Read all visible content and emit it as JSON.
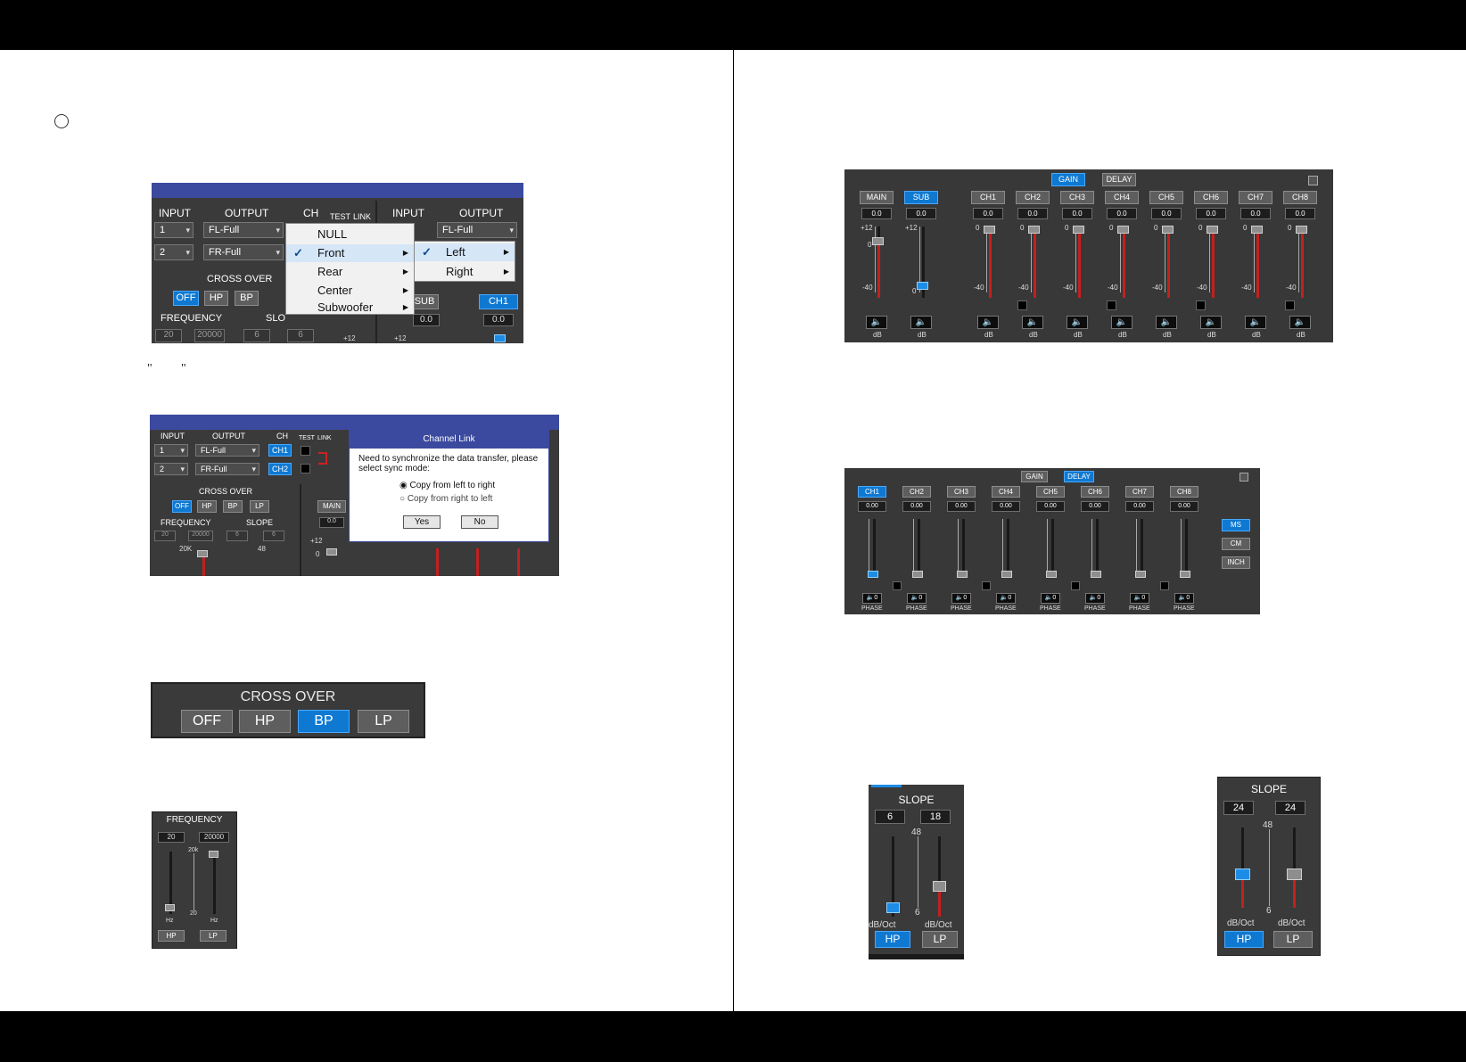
{
  "page": {
    "quote_open": "\"",
    "quote_close": "\""
  },
  "fig1": {
    "rows": [
      {
        "input": "1",
        "output": "FL-Full"
      },
      {
        "input": "2",
        "output": "FR-Full"
      }
    ],
    "headers": {
      "input": "INPUT",
      "output": "OUTPUT",
      "ch": "CH",
      "test": "TEST",
      "link": "LINK"
    },
    "right_headers": {
      "input": "INPUT",
      "output": "OUTPUT"
    },
    "right_output": "FL-Full",
    "crossover_label": "CROSS OVER",
    "crossover_buttons": [
      "OFF",
      "HP",
      "BP"
    ],
    "frequency_label": "FREQUENCY",
    "slope_label": "SLO",
    "freq_values": [
      "20",
      "20000"
    ],
    "slope_values": [
      "6",
      "6"
    ],
    "sub_label": "SUB",
    "sub_value": "0.0",
    "ch1_label": "CH1",
    "ch1_value": "0.0",
    "tick_values": [
      "+12",
      "+12"
    ],
    "menu": [
      "NULL",
      "Front",
      "Rear",
      "Center",
      "Subwoofer"
    ],
    "submenu": [
      "Left",
      "Right"
    ]
  },
  "fig2": {
    "headers": {
      "input": "INPUT",
      "output": "OUTPUT",
      "ch": "CH",
      "test": "TEST",
      "link": "LINK"
    },
    "rows": [
      {
        "input": "1",
        "output": "FL-Full",
        "ch": "CH1"
      },
      {
        "input": "2",
        "output": "FR-Full",
        "ch": "CH2"
      }
    ],
    "crossover_label": "CROSS OVER",
    "crossover_buttons": [
      "OFF",
      "HP",
      "BP",
      "LP"
    ],
    "frequency_label": "FREQUENCY",
    "slope_label": "SLOPE",
    "freq_values": [
      "20",
      "20000"
    ],
    "slope_values": [
      "6",
      "6"
    ],
    "tick_20k": "20K",
    "tick_48": "48",
    "main_label": "MAIN",
    "main_value": "0.0",
    "tick_12": "+12",
    "tick_0": "0",
    "dialog": {
      "title": "Channel Link",
      "message": "Need to synchronize the data transfer, please select sync mode:",
      "option1": "Copy from left to right",
      "option2": "Copy from right to left",
      "yes": "Yes",
      "no": "No"
    }
  },
  "fig3": {
    "title": "CROSS OVER",
    "buttons": [
      "OFF",
      "HP",
      "BP",
      "LP"
    ],
    "active": "BP"
  },
  "fig4": {
    "title": "FREQUENCY",
    "values": [
      "20",
      "20000"
    ],
    "tick_top": "20k",
    "tick_bottom": "20",
    "unit_left": "Hz",
    "unit_right": "Hz",
    "buttons": [
      "HP",
      "LP"
    ]
  },
  "fig5": {
    "tabs": [
      "GAIN",
      "DELAY"
    ],
    "active_tab": "GAIN",
    "channels": [
      {
        "name": "MAIN",
        "value": "0.0",
        "level_db": 0,
        "active": false
      },
      {
        "name": "SUB",
        "value": "0.0",
        "level_db": 0,
        "active": true
      },
      {
        "name": "CH1",
        "value": "0.0",
        "level_db": 0,
        "active": false
      },
      {
        "name": "CH2",
        "value": "0.0",
        "level_db": 0,
        "active": false
      },
      {
        "name": "CH3",
        "value": "0.0",
        "level_db": 0,
        "active": false
      },
      {
        "name": "CH4",
        "value": "0.0",
        "level_db": 0,
        "active": false
      },
      {
        "name": "CH5",
        "value": "0.0",
        "level_db": 0,
        "active": false
      },
      {
        "name": "CH6",
        "value": "0.0",
        "level_db": 0,
        "active": false
      },
      {
        "name": "CH7",
        "value": "0.0",
        "level_db": 0,
        "active": false
      },
      {
        "name": "CH8",
        "value": "0.0",
        "level_db": 0,
        "active": false
      }
    ],
    "tick_top": "+12",
    "tick_zero": "0",
    "tick_bottom": "-40",
    "unit": "dB"
  },
  "fig6": {
    "tabs": [
      "GAIN",
      "DELAY"
    ],
    "active_tab": "DELAY",
    "channels": [
      {
        "name": "CH1",
        "value": "0.00",
        "active": true
      },
      {
        "name": "CH2",
        "value": "0.00",
        "active": false
      },
      {
        "name": "CH3",
        "value": "0.00",
        "active": false
      },
      {
        "name": "CH4",
        "value": "0.00",
        "active": false
      },
      {
        "name": "CH5",
        "value": "0.00",
        "active": false
      },
      {
        "name": "CH6",
        "value": "0.00",
        "active": false
      },
      {
        "name": "CH7",
        "value": "0.00",
        "active": false
      },
      {
        "name": "CH8",
        "value": "0.00",
        "active": false
      }
    ],
    "phase_value": "0",
    "phase_label": "PHASE",
    "units": [
      "MS",
      "CM",
      "INCH"
    ],
    "active_unit": "MS"
  },
  "fig7": {
    "title": "SLOPE",
    "values": [
      "6",
      "18"
    ],
    "tick_top": "48",
    "tick_bottom": "6",
    "unit": "dB/Oct",
    "buttons": [
      "HP",
      "LP"
    ],
    "active": "HP"
  },
  "fig8": {
    "title": "SLOPE",
    "values": [
      "24",
      "24"
    ],
    "tick_top": "48",
    "tick_bottom": "6",
    "unit": "dB/Oct",
    "buttons": [
      "HP",
      "LP"
    ],
    "active": "HP"
  }
}
